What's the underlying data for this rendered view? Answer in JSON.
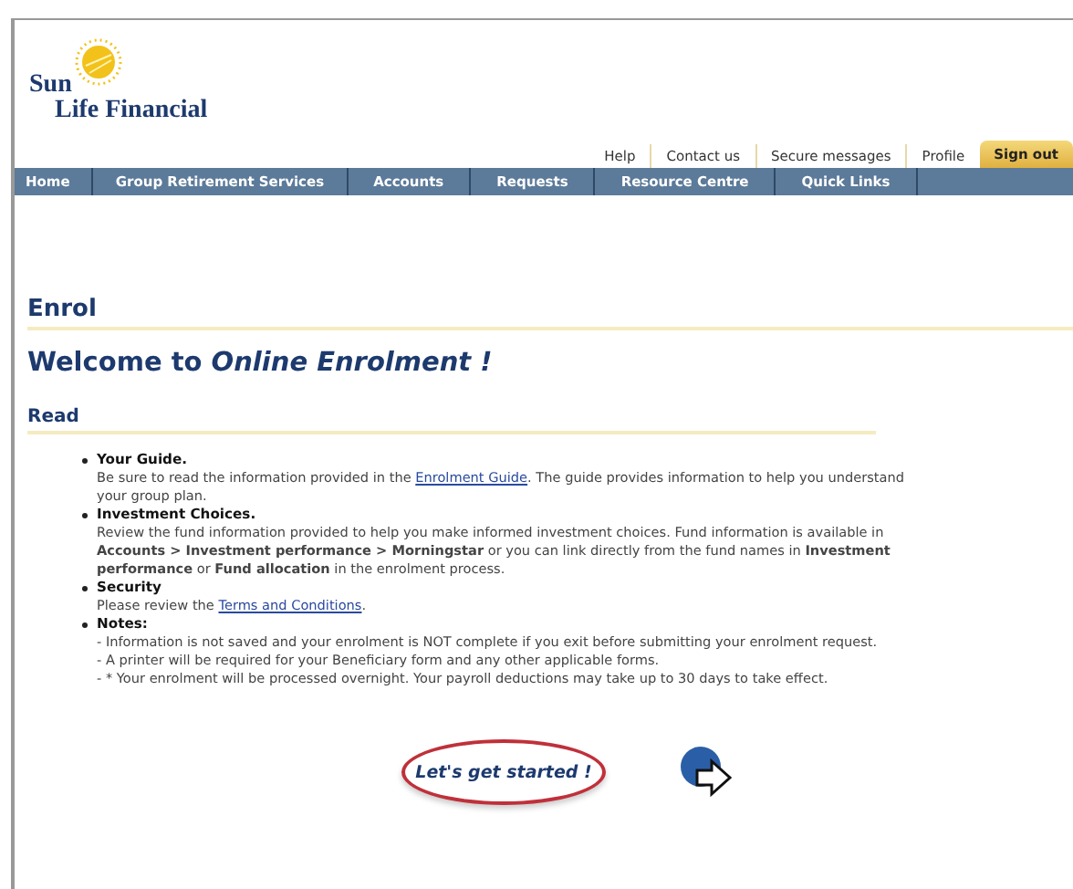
{
  "logo": {
    "line1": "Sun",
    "line2": "Life Financial"
  },
  "top_links": [
    {
      "label": "Help",
      "kind": "link"
    },
    {
      "label": "Contact us",
      "kind": "link"
    },
    {
      "label": "Secure messages",
      "kind": "link"
    },
    {
      "label": "Profile",
      "kind": "link"
    },
    {
      "label": "Sign out",
      "kind": "signout"
    }
  ],
  "nav": [
    "Home",
    "Group Retirement Services",
    "Accounts",
    "Requests",
    "Resource Centre",
    "Quick Links"
  ],
  "page_title": "Enrol",
  "welcome": "Welcome to *Online Enrolment !*",
  "section_title": "Read",
  "items": [
    {
      "title": "Your Guide.",
      "paragraphs": [
        [
          {
            "kind": "text",
            "text": "Be sure to read the information provided in the "
          },
          {
            "kind": "link",
            "text": "Enrolment Guide"
          },
          {
            "kind": "text",
            "text": ". The guide provides information to help you understand your group plan."
          }
        ]
      ]
    },
    {
      "title": "Investment Choices.",
      "paragraphs": [
        [
          {
            "kind": "text",
            "text": "Review the fund information provided to help you make informed investment choices. Fund information is available in **Accounts > Investment performance > Morningstar** or you can link directly from the fund names in **Investment performance** or **Fund allocation** in the enrolment process."
          }
        ]
      ]
    },
    {
      "title": "Security",
      "paragraphs": [
        [
          {
            "kind": "text",
            "text": "Please review the "
          },
          {
            "kind": "link",
            "text": "Terms and Conditions"
          },
          {
            "kind": "text",
            "text": "."
          }
        ]
      ]
    },
    {
      "title": "Notes:",
      "paragraphs": [
        [
          {
            "kind": "text",
            "text": "- Information is not saved and your enrolment is NOT complete if you exit before submitting your enrolment request."
          }
        ],
        [
          {
            "kind": "text",
            "text": "- A printer will be required for your Beneficiary form and any other applicable forms."
          }
        ],
        [
          {
            "kind": "text",
            "text": "- * Your enrolment will be processed overnight. Your payroll deductions may take up to 30 days to take effect."
          }
        ]
      ]
    }
  ],
  "start_button": "Let's get started !"
}
